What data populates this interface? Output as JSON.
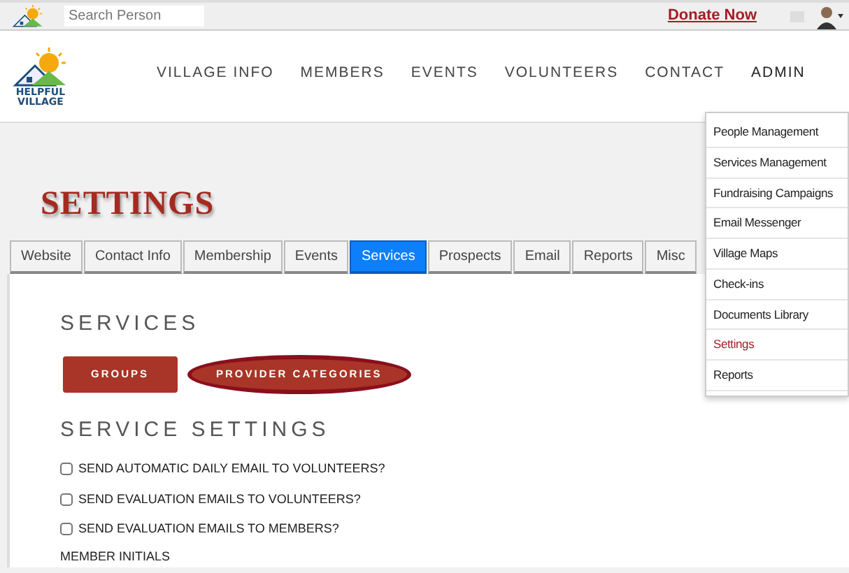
{
  "topbar": {
    "search": {
      "placeholder": "Search Person"
    },
    "donate_link": "Donate Now"
  },
  "header": {
    "logo_text": [
      "HELPFUL",
      "VILLAGE"
    ],
    "nav": [
      {
        "label": "VILLAGE INFO",
        "selected": false
      },
      {
        "label": "MEMBERS",
        "selected": false
      },
      {
        "label": "EVENTS",
        "selected": false
      },
      {
        "label": "VOLUNTEERS",
        "selected": false
      },
      {
        "label": "CONTACT",
        "selected": false
      },
      {
        "label": "ADMIN",
        "selected": true
      }
    ]
  },
  "admin_menu": [
    {
      "label": "People Management",
      "selected": false
    },
    {
      "label": "Services Management",
      "selected": false
    },
    {
      "label": "Fundraising Campaigns",
      "selected": false
    },
    {
      "label": "Email Messenger",
      "selected": false
    },
    {
      "label": "Village Maps",
      "selected": false
    },
    {
      "label": "Check-ins",
      "selected": false
    },
    {
      "label": "Documents Library",
      "selected": false
    },
    {
      "label": "Settings",
      "selected": true
    },
    {
      "label": "Reports",
      "selected": false
    }
  ],
  "page_title": "SETTINGS",
  "tabs": [
    {
      "label": "Website",
      "selected": false
    },
    {
      "label": "Contact Info",
      "selected": false
    },
    {
      "label": "Membership",
      "selected": false
    },
    {
      "label": "Events",
      "selected": false
    },
    {
      "label": "Services",
      "selected": true
    },
    {
      "label": "Prospects",
      "selected": false
    },
    {
      "label": "Email",
      "selected": false
    },
    {
      "label": "Reports",
      "selected": false
    },
    {
      "label": "Misc",
      "selected": false
    }
  ],
  "services": {
    "heading": "SERVICES",
    "buttons": [
      {
        "label": "GROUPS",
        "circled": false
      },
      {
        "label": "PROVIDER CATEGORIES",
        "circled": true
      }
    ]
  },
  "service_settings": {
    "heading": "SERVICE SETTINGS",
    "options": [
      {
        "label": "SEND AUTOMATIC DAILY EMAIL TO VOLUNTEERS?",
        "checked": false
      },
      {
        "label": "SEND EVALUATION EMAILS TO VOLUNTEERS?",
        "checked": false
      },
      {
        "label": "SEND EVALUATION EMAILS TO MEMBERS?",
        "checked": false
      }
    ],
    "next_label": "MEMBER INITIALS"
  }
}
